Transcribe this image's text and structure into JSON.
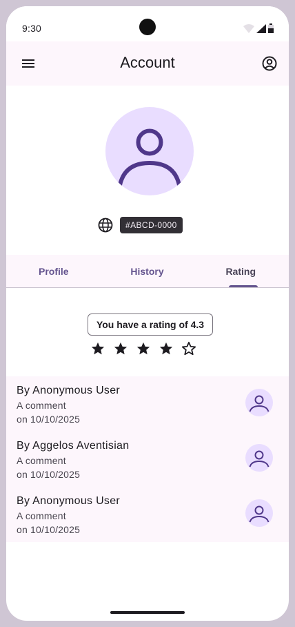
{
  "status_bar": {
    "time": "9:30"
  },
  "app_bar": {
    "title": "Account"
  },
  "profile": {
    "user_id": "#ABCD-0000"
  },
  "tabs": [
    {
      "label": "Profile",
      "active": false
    },
    {
      "label": "History",
      "active": false
    },
    {
      "label": "Rating",
      "active": true
    }
  ],
  "rating": {
    "summary": "You have a rating of 4.3",
    "value": 4.3,
    "stars_filled": 4,
    "stars_total": 5
  },
  "reviews": [
    {
      "author": "By Anonymous User",
      "comment": "A comment",
      "date": "on 10/10/2025"
    },
    {
      "author": "By Aggelos Aventisian",
      "comment": "A comment",
      "date": "on 10/10/2025"
    },
    {
      "author": "By Anonymous User",
      "comment": "A comment",
      "date": "on 10/10/2025"
    }
  ],
  "colors": {
    "primary": "#65558f",
    "primary_container": "#e9ddff",
    "surface": "#fdf6fc",
    "on_surface": "#1d1b20"
  },
  "icons": {
    "menu": "menu-icon",
    "account": "account-circle-icon",
    "globe": "globe-icon",
    "star_filled": "star-filled-icon",
    "star_outline": "star-outline-icon"
  }
}
